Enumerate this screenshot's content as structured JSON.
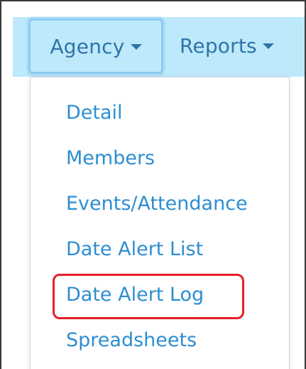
{
  "navbar": {
    "agency_label": "Agency",
    "reports_label": "Reports"
  },
  "dropdown": {
    "items": [
      {
        "label": "Detail"
      },
      {
        "label": "Members"
      },
      {
        "label": "Events/Attendance"
      },
      {
        "label": "Date Alert List"
      },
      {
        "label": "Date Alert Log"
      },
      {
        "label": "Spreadsheets"
      }
    ],
    "highlighted_item": "Date Alert Log",
    "highlight_color": "#e5202a"
  },
  "colors": {
    "navbar_bg": "#bde9fb",
    "nav_text": "#2f74a8",
    "menu_text": "#2d8ed1"
  }
}
